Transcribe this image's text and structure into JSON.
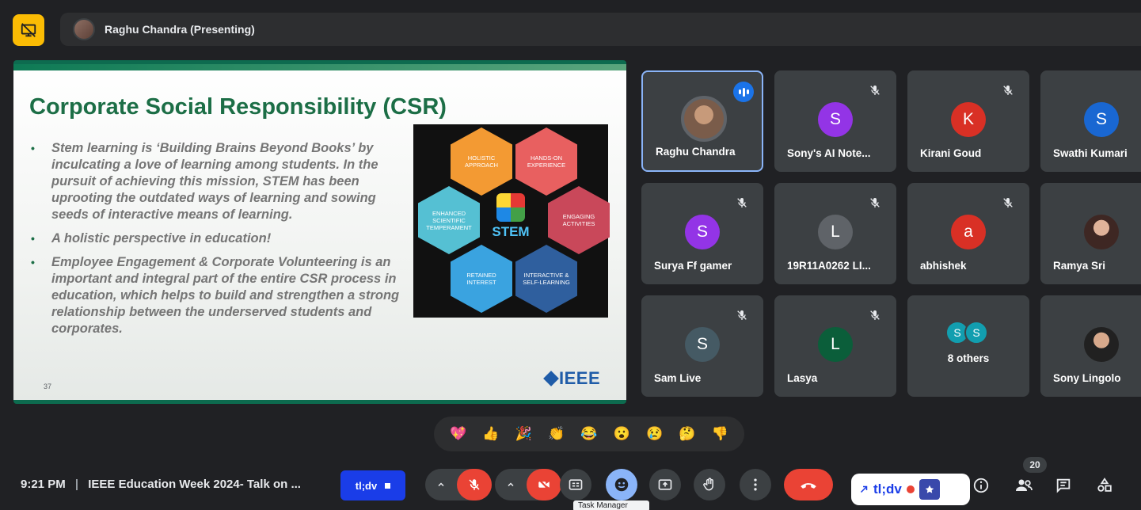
{
  "presenter_bar": {
    "label": "Raghu Chandra (Presenting)"
  },
  "slide": {
    "title": "Corporate Social Responsibility (CSR)",
    "bullets": [
      "Stem learning is ‘Building Brains Beyond Books’ by inculcating a love of learning among students. In the pursuit of achieving this mission, STEM has been uprooting the outdated ways of learning and sowing seeds of interactive means of learning.",
      "A holistic perspective in education!",
      "Employee Engagement & Corporate Volunteering is an important and integral part of the entire CSR process in education, which helps to build and strengthen a strong relationship between the underserved students and corporates."
    ],
    "slide_number": "37",
    "logo_text": "IEEE",
    "stem_graphic": {
      "center_text": "STEM",
      "hexes": [
        {
          "label": "HOLISTIC APPROACH",
          "color": "#f39a33"
        },
        {
          "label": "HANDS-ON EXPERIENCE",
          "color": "#e86060"
        },
        {
          "label": "ENHANCED SCIENTIFIC TEMPERAMENT",
          "color": "#55c0d3"
        },
        {
          "label": "ENGAGING ACTIVITIES",
          "color": "#c9485a"
        },
        {
          "label": "RETAINED INTEREST",
          "color": "#3aa3e0"
        },
        {
          "label": "INTERACTIVE & SELF-LEARNING",
          "color": "#2f5f9e"
        }
      ]
    }
  },
  "participants": [
    {
      "name": "Raghu Chandra",
      "avatar_type": "photo",
      "speaking": true
    },
    {
      "name": "Sony's AI Note...",
      "initial": "S",
      "color": "#9334e6"
    },
    {
      "name": "Kirani Goud",
      "initial": "K",
      "color": "#d93025"
    },
    {
      "name": "Swathi Kumari",
      "initial": "S",
      "color": "#1967d2"
    },
    {
      "name": "Surya Ff gamer",
      "initial": "S",
      "color": "#9334e6"
    },
    {
      "name": "19R11A0262 LI...",
      "initial": "L",
      "color": "#5f6368"
    },
    {
      "name": "abhishek",
      "initial": "a",
      "color": "#d93025"
    },
    {
      "name": "Ramya Sri",
      "avatar_type": "photo"
    },
    {
      "name": "Sam Live",
      "initial": "S",
      "color": "#455a64"
    },
    {
      "name": "Lasya",
      "initial": "L",
      "color": "#0b5e3a"
    },
    {
      "name": "8 others",
      "initials": [
        "S",
        "S"
      ],
      "color": "#129eaf"
    },
    {
      "name": "Sony Lingolo",
      "avatar_type": "photo"
    }
  ],
  "reactions": [
    "💖",
    "👍",
    "🎉",
    "👏",
    "😂",
    "😮",
    "😢",
    "🤔",
    "👎"
  ],
  "bottom_bar": {
    "time": "9:21 PM",
    "separator": "|",
    "meeting_title": "IEEE Education Week 2024- Talk on ...",
    "tldv_chip_label": "tl;dv",
    "tooltip": "Task Manager",
    "tldv_widget_label": "tl;dv",
    "people_count": "20"
  },
  "colors": {
    "background": "#202124",
    "tile": "#3c4043",
    "danger": "#ea4335",
    "accent_blue": "#8ab4f8",
    "slide_green": "#1c6e46"
  }
}
